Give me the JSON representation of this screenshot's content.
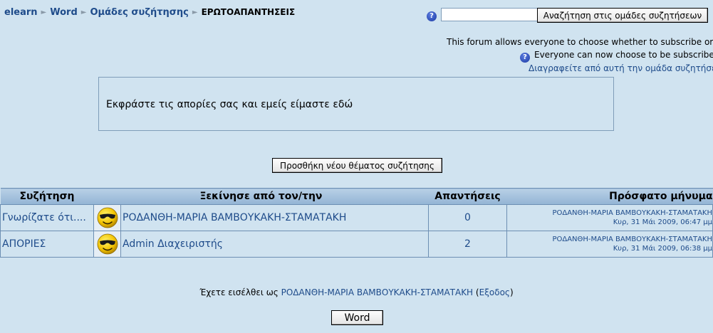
{
  "breadcrumb": {
    "items": [
      "elearn",
      "Word",
      "Ομάδες συζήτησης"
    ],
    "current": "ΕΡΩΤΟΑΠΑΝΤΗΣΕΙΣ",
    "separator": "►"
  },
  "search": {
    "value": "",
    "button_label": "Αναζήτηση στις ομάδες συζητήσεων"
  },
  "subscription": {
    "note": "This forum allows everyone to choose whether to subscribe or not",
    "status": "Everyone can now choose to be subscribed",
    "unsubscribe_link": "Διαγραφείτε από αυτή την ομάδα συζητήσεων"
  },
  "intro": {
    "text": "Εκφράστε τις απορίες σας και εμείς είμαστε εδώ"
  },
  "add_topic_label": "Προσθήκη νέου θέματος συζήτησης",
  "table": {
    "headers": {
      "topic": "Συζήτηση",
      "starter": "Ξεκίνησε από τον/την",
      "replies": "Απαντήσεις",
      "last_post": "Πρόσφατο μήνυμα"
    },
    "rows": [
      {
        "topic": "Γνωρίζατε ότι....",
        "starter": "ΡΟΔΑΝΘΗ-ΜΑΡΙΑ ΒΑΜΒΟΥΚΑΚΗ-ΣΤΑΜΑΤΑΚΗ",
        "replies": "0",
        "last_author": "ΡΟΔΑΝΘΗ-ΜΑΡΙΑ ΒΑΜΒΟΥΚΑΚΗ-ΣΤΑΜΑΤΑΚΗ",
        "last_date": "Κυρ, 31 Μάι 2009, 06:47 μμ"
      },
      {
        "topic": "ΑΠΟΡΙΕΣ",
        "starter": "Admin Διαχειριστής",
        "replies": "2",
        "last_author": "ΡΟΔΑΝΘΗ-ΜΑΡΙΑ ΒΑΜΒΟΥΚΑΚΗ-ΣΤΑΜΑΤΑΚΗ",
        "last_date": "Κυρ, 31 Μάι 2009, 06:38 μμ"
      }
    ]
  },
  "footer": {
    "logged_in_prefix": "Έχετε εισέλθει ως",
    "user_name": "ΡΟΔΑΝΘΗ-ΜΑΡΙΑ ΒΑΜΒΟΥΚΑΚΗ-ΣΤΑΜΑΤΑΚΗ",
    "logout_open": "(",
    "logout_label": "Εξοδος",
    "logout_close": ")",
    "home_button_label": "Word"
  },
  "icons": {
    "help": "help-icon",
    "avatar": "smiley-sunglasses-icon"
  },
  "colors": {
    "background": "#d0e3f0",
    "link": "#1e4b8a",
    "header_bg": "#a9c4de",
    "border": "#6d8fb3"
  }
}
